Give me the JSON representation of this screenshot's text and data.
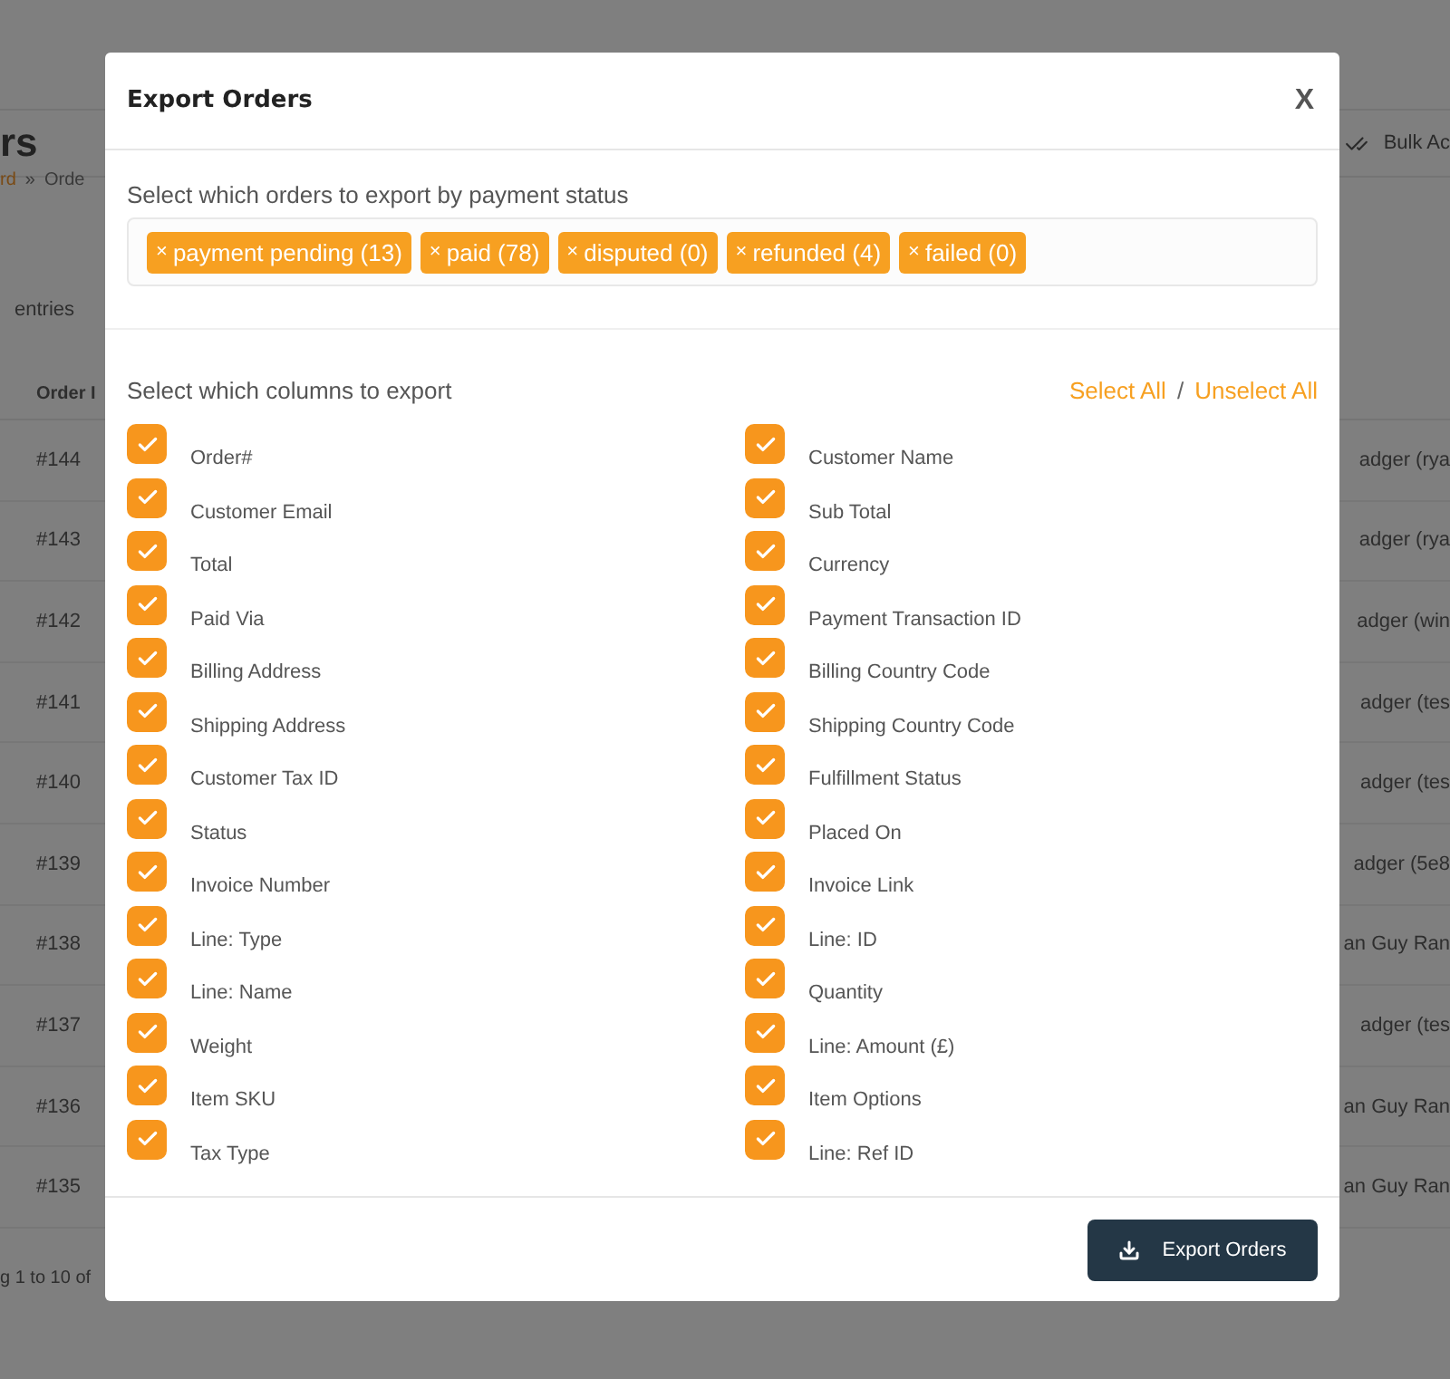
{
  "background": {
    "page_title": "rs",
    "breadcrumb": [
      {
        "label": "rd",
        "kind": "link"
      },
      {
        "label": "»",
        "kind": "separator"
      },
      {
        "label": "Orde",
        "kind": "text"
      }
    ],
    "bulk_actions": "Bulk Ac",
    "entries_label": "entries",
    "table": {
      "columns": [
        "Order I"
      ],
      "rows": [
        {
          "order": "#144",
          "customer": "adger (rya"
        },
        {
          "order": "#143",
          "customer": "adger (rya"
        },
        {
          "order": "#142",
          "customer": "adger (win"
        },
        {
          "order": "#141",
          "customer": "adger (tes"
        },
        {
          "order": "#140",
          "customer": "adger (tes"
        },
        {
          "order": "#139",
          "customer": "adger (5e8"
        },
        {
          "order": "#138",
          "customer": "an Guy Ran"
        },
        {
          "order": "#137",
          "customer": "adger (tes"
        },
        {
          "order": "#136",
          "customer": "an Guy Ran"
        },
        {
          "order": "#135",
          "customer": "an Guy Ran"
        }
      ]
    },
    "footer": "g 1 to 10 of"
  },
  "dialog": {
    "title": "Export Orders",
    "close": "X",
    "status_label": "Select which orders to export by payment status",
    "status_tags": [
      {
        "label": "payment pending (13)",
        "remove": "×"
      },
      {
        "label": "paid (78)",
        "remove": "×"
      },
      {
        "label": "disputed (0)",
        "remove": "×"
      },
      {
        "label": "refunded (4)",
        "remove": "×"
      },
      {
        "label": "failed (0)",
        "remove": "×"
      }
    ],
    "columns_label": "Select which columns to export",
    "select_all": "Select All",
    "separator": "/",
    "unselect_all": "Unselect All",
    "columns": [
      {
        "label": "Order#",
        "checked": true
      },
      {
        "label": "Customer Name",
        "checked": true
      },
      {
        "label": "Customer Email",
        "checked": true
      },
      {
        "label": "Sub Total",
        "checked": true
      },
      {
        "label": "Total",
        "checked": true
      },
      {
        "label": "Currency",
        "checked": true
      },
      {
        "label": "Paid Via",
        "checked": true
      },
      {
        "label": "Payment Transaction ID",
        "checked": true
      },
      {
        "label": "Billing Address",
        "checked": true
      },
      {
        "label": "Billing Country Code",
        "checked": true
      },
      {
        "label": "Shipping Address",
        "checked": true
      },
      {
        "label": "Shipping Country Code",
        "checked": true
      },
      {
        "label": "Customer Tax ID",
        "checked": true
      },
      {
        "label": "Fulfillment Status",
        "checked": true
      },
      {
        "label": "Status",
        "checked": true
      },
      {
        "label": "Placed On",
        "checked": true
      },
      {
        "label": "Invoice Number",
        "checked": true
      },
      {
        "label": "Invoice Link",
        "checked": true
      },
      {
        "label": "Line: Type",
        "checked": true
      },
      {
        "label": "Line: ID",
        "checked": true
      },
      {
        "label": "Line: Name",
        "checked": true
      },
      {
        "label": "Quantity",
        "checked": true
      },
      {
        "label": "Weight",
        "checked": true
      },
      {
        "label": "Line: Amount (£)",
        "checked": true
      },
      {
        "label": "Item SKU",
        "checked": true
      },
      {
        "label": "Item Options",
        "checked": true
      },
      {
        "label": "Tax Type",
        "checked": true
      },
      {
        "label": "Line: Ref ID",
        "checked": true
      }
    ],
    "export_button": "Export Orders"
  }
}
